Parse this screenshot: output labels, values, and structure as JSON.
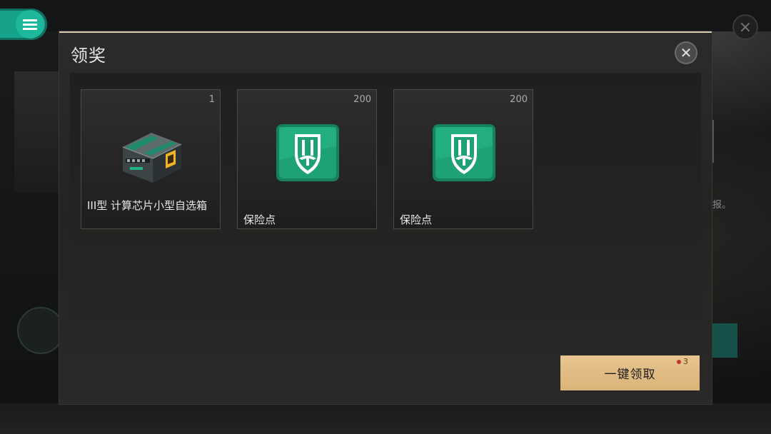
{
  "modal": {
    "title": "领奖",
    "close_icon": "close-icon"
  },
  "rewards": [
    {
      "name": "III型 计算芯片小型自选箱",
      "quantity": "1",
      "icon": "chip-box-icon"
    },
    {
      "name": "保险点",
      "quantity": "200",
      "icon": "insurance-point-icon"
    },
    {
      "name": "保险点",
      "quantity": "200",
      "icon": "insurance-point-icon"
    }
  ],
  "claim_all": {
    "label": "一键领取",
    "badge_count": "3"
  },
  "background": {
    "menu_icon": "menu-icon",
    "side_text": "报。",
    "accent_color": "#17a38b",
    "button_color": "#e8c58f"
  }
}
